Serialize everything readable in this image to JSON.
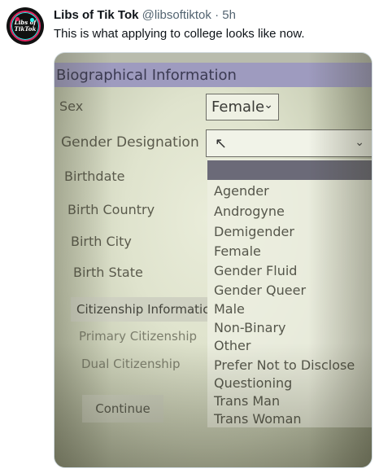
{
  "tweet": {
    "display_name": "Libs of Tik Tok",
    "handle": "@libsoftiktok",
    "separator": "·",
    "time": "5h",
    "text": "This is what applying to college looks like now.",
    "avatar_logo_text_1": "Libs of",
    "avatar_logo_text_2": "TikTok"
  },
  "form": {
    "section_title": "Biographical Information",
    "labels": {
      "sex": "Sex",
      "gender": "Gender Designation",
      "birthdate": "Birthdate",
      "birth_country": "Birth Country",
      "birth_city": "Birth City",
      "birth_state": "Birth State",
      "primary_citizenship": "Primary Citizenship",
      "dual_citizenship": "Dual Citizenship"
    },
    "sex_value": "Female",
    "citizenship_header": "Citizenship Informatic",
    "continue_label": "Continue",
    "gender_options": [
      "Agender",
      "Androgyne",
      "Demigender",
      "Female",
      "Gender Fluid",
      "Gender Queer",
      "Male",
      "Non-Binary",
      "Other",
      "Prefer Not to Disclose",
      "Questioning",
      "Trans Man",
      "Trans Woman"
    ]
  },
  "colors": {
    "header_bg": "#9e9bbf",
    "highlight_bg": "#6b6a78",
    "muted_text": "#536471"
  }
}
